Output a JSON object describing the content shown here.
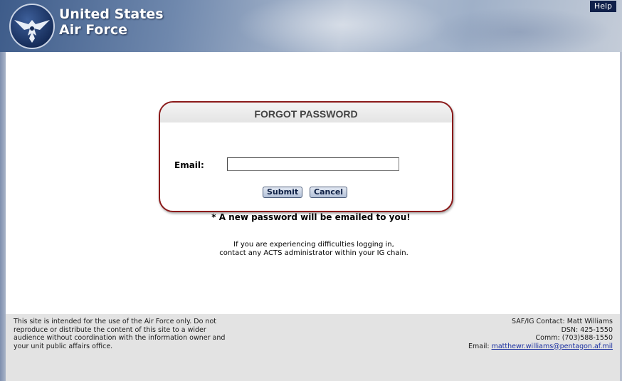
{
  "header": {
    "brand_line1": "United States",
    "brand_line2": "Air Force",
    "help_label": "Help"
  },
  "form": {
    "title": "FORGOT PASSWORD",
    "email_label": "Email:",
    "email_value": "",
    "submit_label": "Submit",
    "cancel_label": "Cancel"
  },
  "note": "* A new password will be emailed to you!",
  "help_text": {
    "line1": "If you are experiencing difficulties logging in,",
    "line2": "contact any ACTS administrator within your IG chain."
  },
  "footer": {
    "disclaimer_lines": [
      "This site is intended for the use of the Air Force only. Do not",
      "reproduce or distribute the content of this site to a wider",
      "audience without coordination with the information owner and",
      "your unit public affairs office."
    ],
    "contact_line": "SAF/IG Contact: Matt Williams",
    "dsn_line": "DSN: 425-1550",
    "comm_line": "Comm: (703)588-1550",
    "email_prefix": "Email:",
    "email_link": "matthewr.williams@pentagon.af.mil"
  },
  "colors": {
    "dialog_border": "#8b1a1a",
    "header_dark": "#3e5c8a",
    "link": "#1a2fa0"
  },
  "icons": {
    "logo": "air-force-wings-logo"
  }
}
